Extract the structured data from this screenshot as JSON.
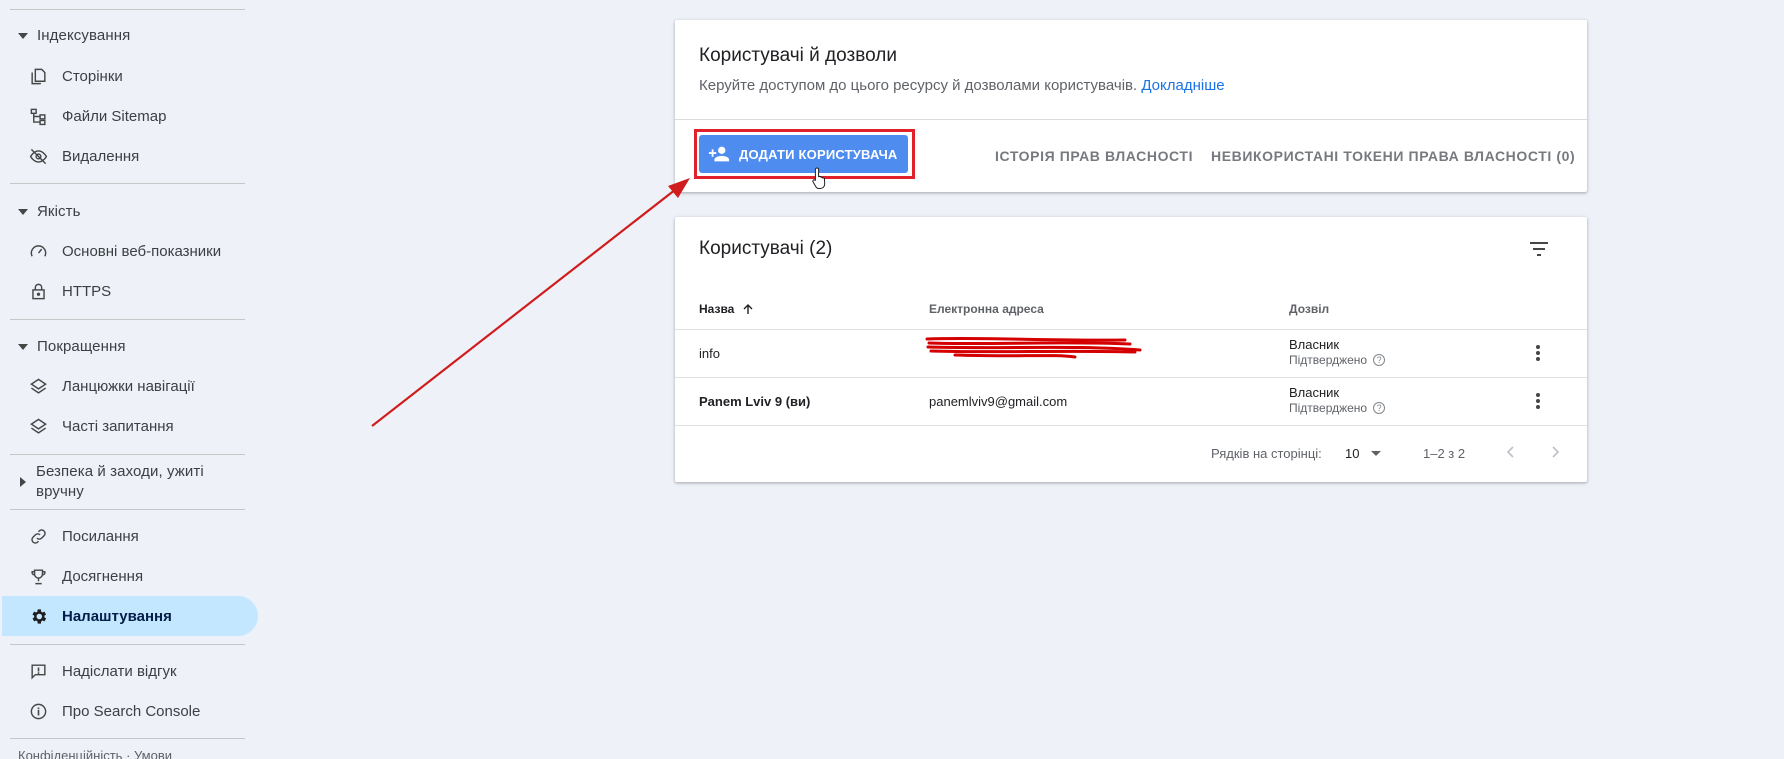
{
  "sidebar": {
    "indexing": {
      "header": "Індексування",
      "items": [
        {
          "label": "Сторінки",
          "icon": "pages-icon"
        },
        {
          "label": "Файли Sitemap",
          "icon": "sitemap-icon"
        },
        {
          "label": "Видалення",
          "icon": "removals-icon"
        }
      ]
    },
    "quality": {
      "header": "Якість",
      "items": [
        {
          "label": "Основні веб-показники",
          "icon": "speedometer-icon"
        },
        {
          "label": "HTTPS",
          "icon": "lock-icon"
        }
      ]
    },
    "enhancements": {
      "header": "Покращення",
      "items": [
        {
          "label": "Ланцюжки навігації",
          "icon": "layers-icon"
        },
        {
          "label": "Часті запитання",
          "icon": "layers-icon"
        }
      ]
    },
    "security": {
      "header": "Безпека й заходи, ужиті вручну"
    },
    "links": {
      "label": "Посилання",
      "icon": "link-icon"
    },
    "achievements": {
      "label": "Досягнення",
      "icon": "trophy-icon"
    },
    "settings": {
      "label": "Налаштування",
      "icon": "gear-icon"
    },
    "feedback": {
      "label": "Надіслати відгук",
      "icon": "feedback-icon"
    },
    "about": {
      "label": "Про Search Console",
      "icon": "info-icon"
    },
    "footer": "Конфіденційність · Умови"
  },
  "permissions_card": {
    "title": "Користувачі й дозволи",
    "description": "Керуйте доступом до цього ресурсу й дозволами користувачів.",
    "learn_more": "Докладніше",
    "add_user_label": "ДОДАТИ КОРИСТУВАЧА",
    "ownership_history": "ІСТОРІЯ ПРАВ ВЛАСНОСТІ",
    "unused_tokens": "НЕВИКОРИСТАНІ ТОКЕНИ ПРАВА ВЛАСНОСТІ (0)"
  },
  "users_card": {
    "title": "Користувачі (2)",
    "columns": {
      "name": "Назва",
      "email": "Електронна адреса",
      "permission": "Дозвіл"
    },
    "rows": [
      {
        "name": "info",
        "email": "",
        "permission": "Власник",
        "status": "Підтверджено"
      },
      {
        "name": "Panem Lviv 9 (ви)",
        "email": "panemlviv9@gmail.com",
        "permission": "Власник",
        "status": "Підтверджено"
      }
    ],
    "pagination": {
      "rows_per_page_label": "Рядків на сторінці:",
      "rows_per_page": "10",
      "range": "1–2 з 2"
    }
  },
  "colors": {
    "accent": "#4e8cf0",
    "highlight": "#e0202a",
    "active_nav": "#c2e7ff",
    "link": "#1a73e8"
  }
}
